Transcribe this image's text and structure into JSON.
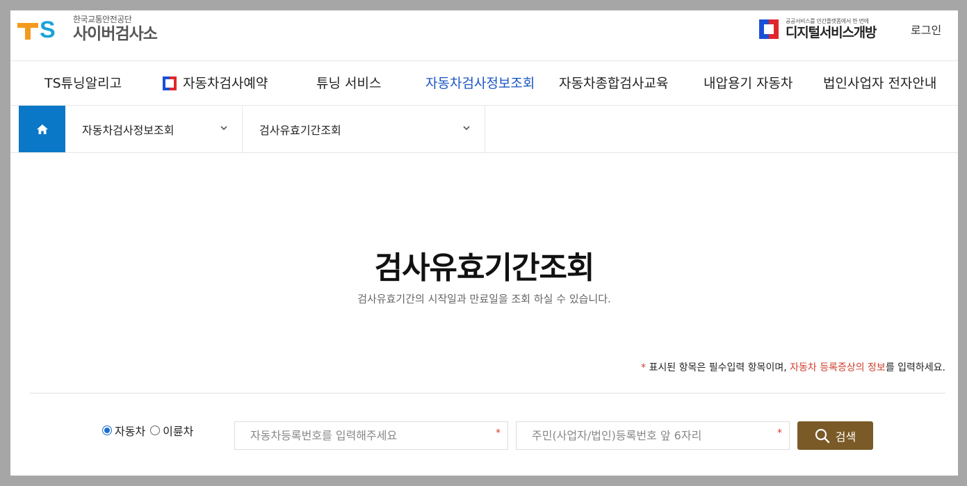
{
  "header": {
    "org_name": "한국교통안전공단",
    "site_name": "사이버검사소",
    "partner_sub": "공공서비스를 민간플랫폼에서 한 번에",
    "partner_main": "디지털서비스개방",
    "login_label": "로그인"
  },
  "gnb": {
    "items": [
      {
        "label": "TS튜닝알리고"
      },
      {
        "label": "자동차검사예약"
      },
      {
        "label": "튜닝 서비스"
      },
      {
        "label": "자동차검사정보조회"
      },
      {
        "label": "자동차종합검사교육"
      },
      {
        "label": "내압용기 자동차"
      },
      {
        "label": "법인사업자 전자안내"
      }
    ],
    "active_index": 3
  },
  "lnb": {
    "depth1": "자동차검사정보조회",
    "depth2": "검사유효기간조회"
  },
  "content": {
    "title": "검사유효기간조회",
    "description": "검사유효기간의 시작일과 만료일을 조회 하실 수 있습니다.",
    "notice_star": "*",
    "notice_part1": " 표시된 항목은 필수입력 항목이며, ",
    "notice_red": "자동차 등록증상의 정보",
    "notice_part2": "를 입력하세요."
  },
  "form": {
    "radio_car": "자동차",
    "radio_bike": "이륜차",
    "selected": "자동차",
    "plate_placeholder": "자동차등록번호를 입력해주세요",
    "id_placeholder": "주민(사업자/법인)등록번호 앞 6자리",
    "required_mark": "*",
    "search_label": "검색"
  },
  "colors": {
    "accent_blue": "#1a56c4",
    "home_blue": "#0a78c6",
    "search_brown": "#7a5a27",
    "required_red": "#d0402d"
  }
}
